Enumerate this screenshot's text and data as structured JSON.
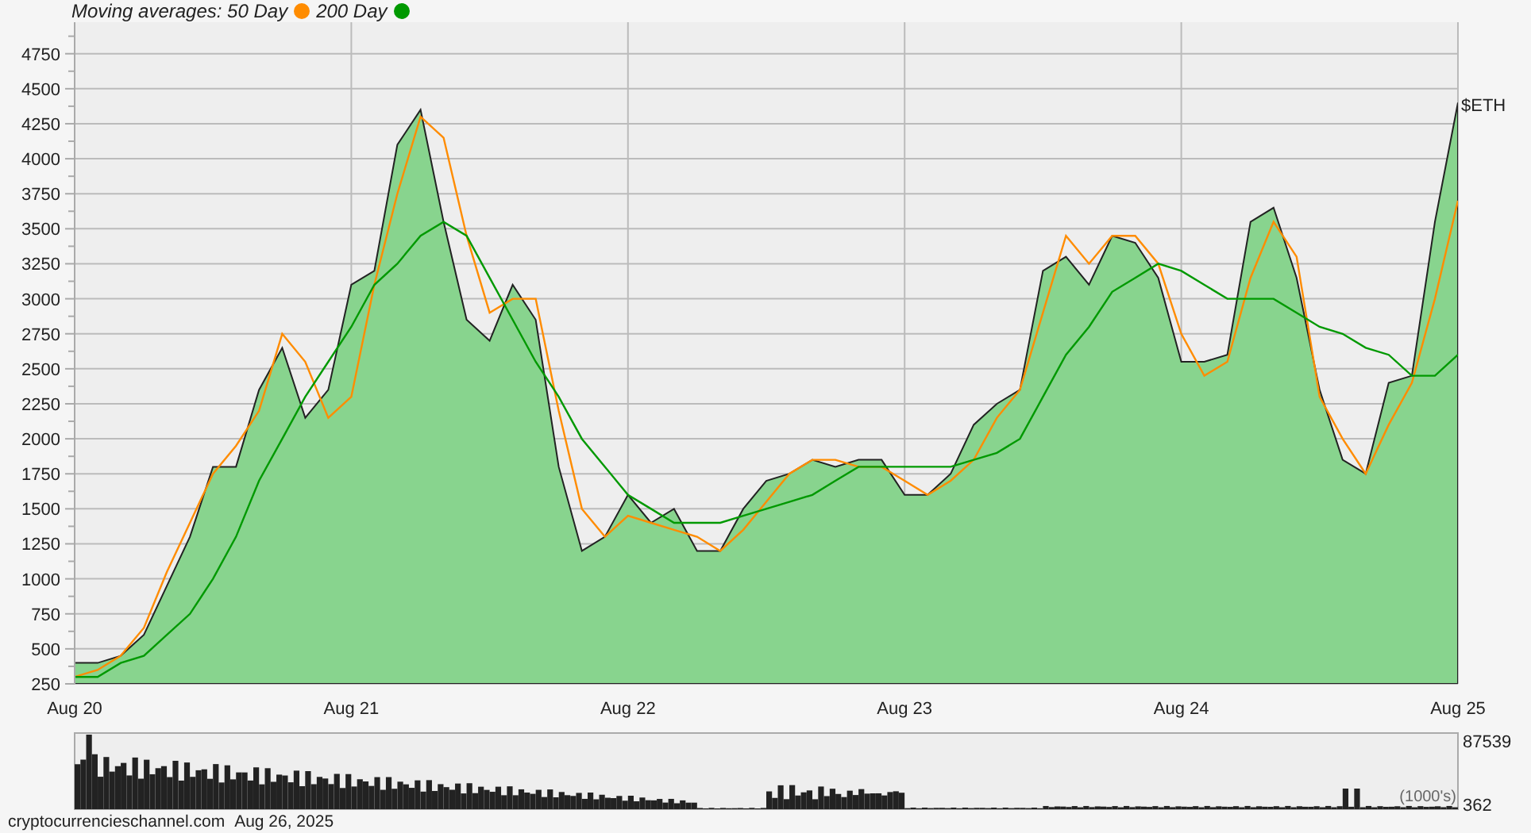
{
  "legend": {
    "title": "Moving averages:"
  },
  "price_chart": {
    "chart_data": {
      "type": "area",
      "categories": [
        "Aug 20",
        null,
        null,
        null,
        null,
        null,
        null,
        null,
        null,
        null,
        null,
        null,
        "Aug 21",
        null,
        null,
        null,
        null,
        null,
        null,
        null,
        null,
        null,
        null,
        null,
        "Aug 22",
        null,
        null,
        null,
        null,
        null,
        null,
        null,
        null,
        null,
        null,
        null,
        "Aug 23",
        null,
        null,
        null,
        null,
        null,
        null,
        null,
        null,
        null,
        null,
        null,
        "Aug 24",
        null,
        null,
        null,
        null,
        null,
        null,
        null,
        null,
        null,
        null,
        null,
        "Aug 25"
      ],
      "ylim": [
        250,
        4975
      ],
      "grid": true,
      "yticks": [
        250,
        500,
        750,
        1000,
        1250,
        1500,
        1750,
        2000,
        2250,
        2500,
        2750,
        3000,
        3250,
        3500,
        3750,
        4000,
        4250,
        4500,
        4750
      ],
      "series": [
        {
          "name": "$ETH",
          "type": "area",
          "color": "#88d48e",
          "values": [
            400,
            400,
            450,
            600,
            950,
            1300,
            1800,
            1800,
            2350,
            2650,
            2150,
            2350,
            3100,
            3200,
            4100,
            4350,
            3550,
            2850,
            2700,
            3100,
            2850,
            1800,
            1200,
            1300,
            1600,
            1400,
            1500,
            1200,
            1200,
            1500,
            1700,
            1750,
            1850,
            1800,
            1850,
            1850,
            1600,
            1600,
            1750,
            2100,
            2250,
            2350,
            3200,
            3300,
            3100,
            3450,
            3400,
            3150,
            2550,
            2550,
            2600,
            3550,
            3650,
            3150,
            2350,
            1850,
            1750,
            2400,
            2450,
            3550,
            4400
          ]
        },
        {
          "name": "50 Day",
          "type": "line",
          "color": "#ff8c00",
          "values": [
            300,
            350,
            450,
            650,
            1050,
            1400,
            1750,
            1950,
            2200,
            2750,
            2550,
            2150,
            2300,
            3100,
            3750,
            4300,
            4150,
            3450,
            2900,
            3000,
            3000,
            2200,
            1500,
            1300,
            1450,
            1400,
            1350,
            1300,
            1200,
            1350,
            1550,
            1750,
            1850,
            1850,
            1800,
            1800,
            1700,
            1600,
            1700,
            1850,
            2150,
            2350,
            2900,
            3450,
            3250,
            3450,
            3450,
            3250,
            2750,
            2450,
            2550,
            3150,
            3550,
            3300,
            2300,
            2000,
            1750,
            2100,
            2400,
            3000,
            3700
          ]
        },
        {
          "name": "200 Day",
          "type": "line",
          "color": "#009900",
          "values": [
            300,
            300,
            400,
            450,
            600,
            750,
            1000,
            1300,
            1700,
            2000,
            2300,
            2550,
            2800,
            3100,
            3250,
            3450,
            3550,
            3450,
            3150,
            2850,
            2550,
            2300,
            2000,
            1800,
            1600,
            1500,
            1400,
            1400,
            1400,
            1450,
            1500,
            1550,
            1600,
            1700,
            1800,
            1800,
            1800,
            1800,
            1800,
            1850,
            1900,
            2000,
            2300,
            2600,
            2800,
            3050,
            3150,
            3250,
            3200,
            3100,
            3000,
            3000,
            3000,
            2900,
            2800,
            2750,
            2650,
            2600,
            2450,
            2450,
            2600
          ]
        }
      ]
    }
  },
  "volume_chart": {
    "max_label": "87539",
    "min_label": "362",
    "unit": "(1000's)"
  },
  "footer": {
    "source": "cryptocurrencieschannel.com",
    "date": "Aug 26, 2025"
  }
}
